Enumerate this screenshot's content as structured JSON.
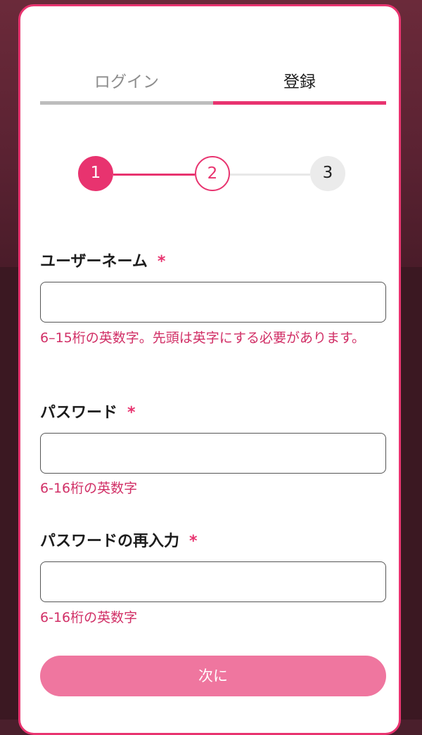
{
  "tabs": {
    "login": "ログイン",
    "register": "登録",
    "active": "register"
  },
  "stepper": {
    "steps": [
      "1",
      "2",
      "3"
    ],
    "current": 2
  },
  "form": {
    "required_mark": "*",
    "username": {
      "label": "ユーザーネーム",
      "value": "",
      "hint": "6–15桁の英数字。先頭は英字にする必要があります。"
    },
    "password": {
      "label": "パスワード",
      "value": "",
      "hint": "6-16桁の英数字"
    },
    "password_confirm": {
      "label": "パスワードの再入力",
      "value": "",
      "hint": "6-16桁の英数字"
    }
  },
  "next_button": "次に",
  "colors": {
    "accent": "#e8336f",
    "button": "#ef769f",
    "hint": "#d12f66"
  }
}
